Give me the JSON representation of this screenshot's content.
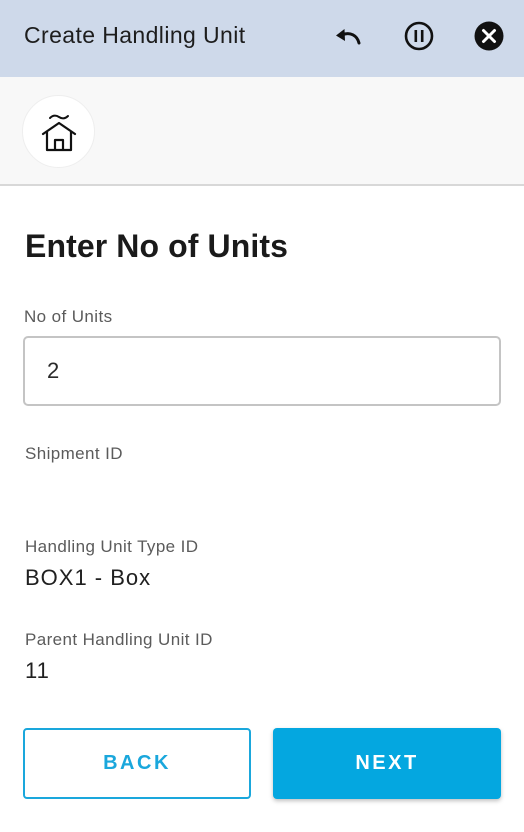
{
  "header": {
    "title": "Create Handling Unit",
    "icons": [
      "undo-icon",
      "pause-icon",
      "close-icon"
    ]
  },
  "home": {
    "icon": "home-icon"
  },
  "form": {
    "title": "Enter No of Units",
    "units_label": "No of Units",
    "units_value": "2",
    "shipment_label": "Shipment ID",
    "shipment_value": "",
    "hu_type_label": "Handling Unit Type ID",
    "hu_type_value": "BOX1 - Box",
    "parent_label": "Parent Handling Unit ID",
    "parent_value": "11"
  },
  "actions": {
    "back_label": "BACK",
    "next_label": "NEXT"
  },
  "colors": {
    "header_bg": "#ced9ea",
    "accent": "#04a7e0"
  }
}
